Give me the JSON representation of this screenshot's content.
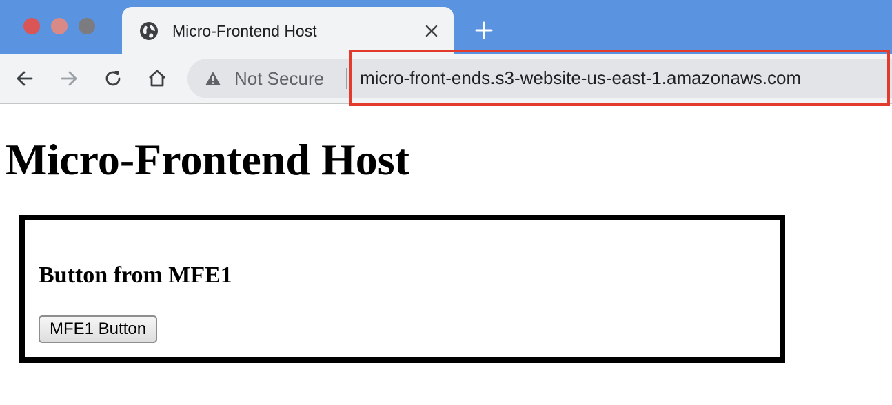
{
  "window": {
    "traffic_lights": [
      "close",
      "minimize",
      "maximize"
    ]
  },
  "tab": {
    "title": "Micro-Frontend Host",
    "icon": "globe-icon",
    "close_icon": "close-icon"
  },
  "new_tab_icon": "plus-icon",
  "toolbar": {
    "back_icon": "back-arrow-icon",
    "forward_icon": "forward-arrow-icon",
    "reload_icon": "reload-icon",
    "home_icon": "home-icon"
  },
  "omnibox": {
    "security_label": "Not Secure",
    "security_icon": "warning-icon",
    "url": "micro-front-ends.s3-website-us-east-1.amazonaws.com",
    "highlight_color": "#e23b2e"
  },
  "page": {
    "title": "Micro-Frontend Host",
    "mfe": {
      "heading": "Button from MFE1",
      "button_label": "MFE1 Button"
    }
  },
  "colors": {
    "titlebar": "#5a93df",
    "toolbar": "#f1f3f4"
  }
}
